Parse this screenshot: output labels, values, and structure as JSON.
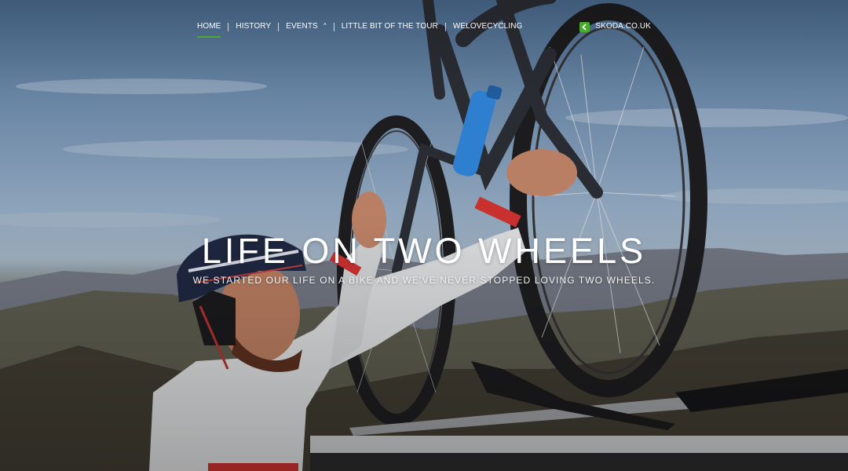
{
  "nav": {
    "items": [
      {
        "label": "HOME",
        "active": true
      },
      {
        "label": "HISTORY",
        "active": false
      },
      {
        "label": "EVENTS",
        "active": false,
        "has_dropdown": true,
        "caret": "^"
      },
      {
        "label": "LITTLE BIT OF THE TOUR",
        "active": false
      },
      {
        "label": "WELOVECYCLING",
        "active": false
      }
    ],
    "external_link": {
      "label": "SKODA.CO.UK",
      "icon": "skoda-arrow-icon"
    }
  },
  "hero": {
    "title": "LIFE ON TWO WHEELS",
    "subtitle": "WE STARTED OUR LIFE ON A BIKE AND WE'VE NEVER STOPPED LOVING TWO WHEELS."
  },
  "colors": {
    "accent": "#4ba82e",
    "text": "#ffffff"
  }
}
